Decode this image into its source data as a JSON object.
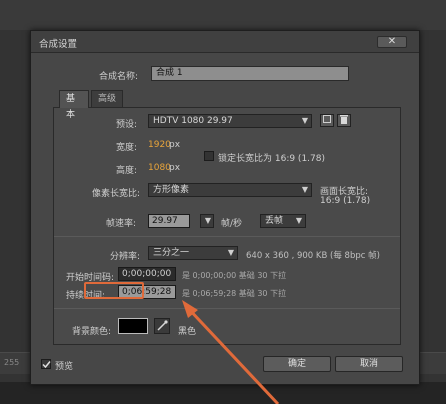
{
  "dialog": {
    "title": "合成设置",
    "close_label": "✕",
    "name_label": "合成名称:",
    "name_value": "合成 1"
  },
  "tabs": [
    {
      "label": "基本",
      "active": true
    },
    {
      "label": "高级",
      "active": false
    }
  ],
  "preset": {
    "label": "预设:",
    "value": "HDTV 1080 29.97"
  },
  "width": {
    "label": "宽度:",
    "value": "1920",
    "unit": "px"
  },
  "height": {
    "label": "高度:",
    "value": "1080",
    "unit": "px"
  },
  "lock_aspect": {
    "label": "锁定长宽比为 16:9 (1.78)",
    "checked": false
  },
  "pixel_aspect": {
    "label": "像素长宽比:",
    "value": "方形像素",
    "frame_aspect_label": "画面长宽比:",
    "frame_aspect_value": "16:9 (1.78)"
  },
  "frame_rate": {
    "label": "帧速率:",
    "value": "29.97",
    "unit": "帧/秒",
    "drop_label": "丢帧"
  },
  "resolution": {
    "label": "分辨率:",
    "value": "三分之一",
    "info": "640 x 360 , 900 KB (每 8bpc 帧)"
  },
  "start_timecode": {
    "label": "开始时间码:",
    "value": "0;00;00;00",
    "info": "是 0;00;00;00  基础 30 下拉"
  },
  "duration": {
    "label": "持续时间:",
    "value": "0;06;59;28",
    "info": "是 0;06;59;28  基础 30 下拉"
  },
  "bg_color": {
    "label": "背景颜色:",
    "name": "黑色",
    "swatch": "#000000"
  },
  "footer": {
    "preview_label": "预览",
    "preview_checked": true,
    "ok_label": "确定",
    "cancel_label": "取消"
  },
  "background_app": {
    "fragment": "255"
  },
  "colors": {
    "accent": "#e8a43a",
    "annotation": "#e06a3a"
  }
}
